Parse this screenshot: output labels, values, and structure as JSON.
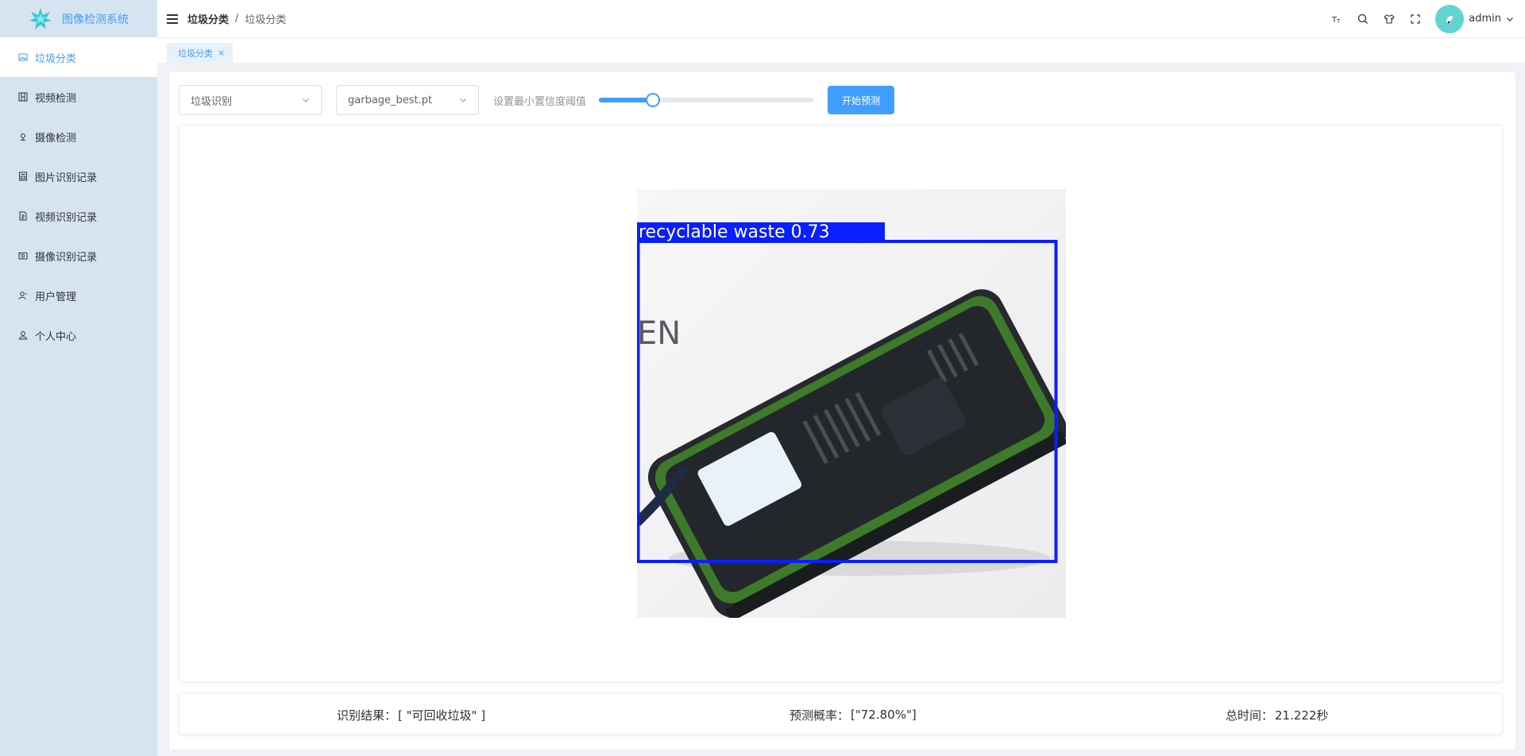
{
  "app": {
    "title": "图像检测系统"
  },
  "sidebar": {
    "items": [
      {
        "label": "垃圾分类",
        "icon": "image-icon",
        "active": true
      },
      {
        "label": "视频检测",
        "icon": "video-icon",
        "active": false
      },
      {
        "label": "摄像检测",
        "icon": "camera-icon",
        "active": false
      },
      {
        "label": "图片识别记录",
        "icon": "image-record-icon",
        "active": false
      },
      {
        "label": "视频识别记录",
        "icon": "video-record-icon",
        "active": false
      },
      {
        "label": "摄像识别记录",
        "icon": "camera-record-icon",
        "active": false
      },
      {
        "label": "用户管理",
        "icon": "user-manage-icon",
        "active": false
      },
      {
        "label": "个人中心",
        "icon": "user-icon",
        "active": false
      }
    ]
  },
  "header": {
    "breadcrumb": [
      "垃圾分类",
      "/",
      "垃圾分类"
    ],
    "icons": [
      "font-size-icon",
      "search-icon",
      "theme-icon",
      "fullscreen-icon"
    ],
    "username": "admin"
  },
  "tabs": [
    {
      "label": "垃圾分类",
      "close": "×"
    }
  ],
  "toolbar": {
    "task_select": "垃圾识别",
    "model_select": "garbage_best.pt",
    "slider_label": "设置最小置信度阈值",
    "slider_value": 0.25,
    "start_button": "开始预测"
  },
  "detection": {
    "label_text": "recyclable waste 0.73",
    "box_color": "#0a1fff"
  },
  "result": {
    "result_label": "识别结果：",
    "result_value": "[ \"可回收垃圾\" ]",
    "prob_label": "预测概率：",
    "prob_value": "[\"72.80%\"]",
    "time_label": "总时间：",
    "time_value": "21.222秒"
  },
  "colors": {
    "accent": "#409eff",
    "sidebar_bg": "#d6e4f2",
    "avatar_bg": "#62d3d0"
  }
}
